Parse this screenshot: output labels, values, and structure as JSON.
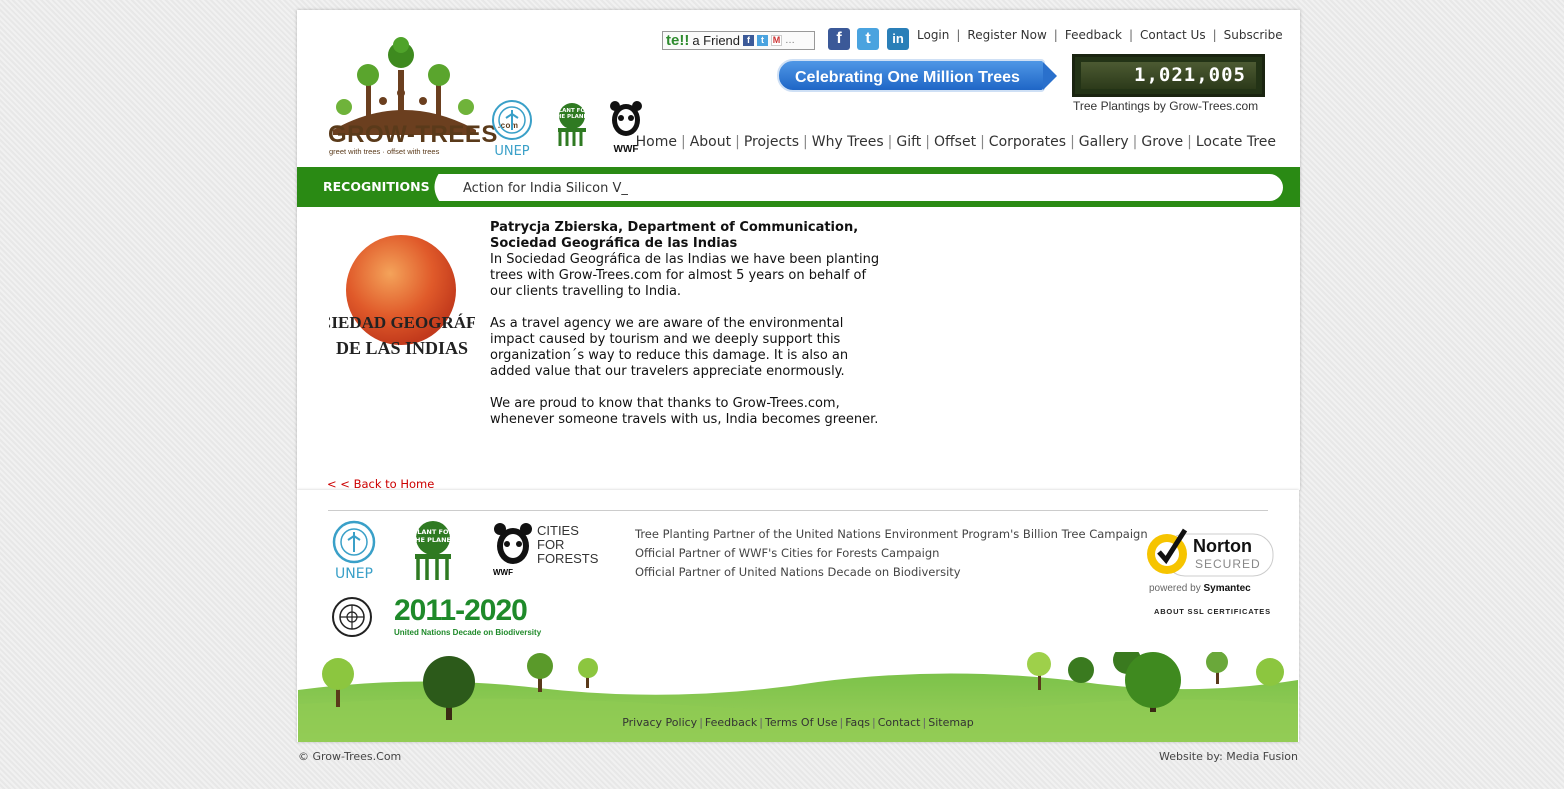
{
  "header": {
    "logo_text": "GROW-TREES",
    "logo_com": ".com",
    "logo_tagline": "greet with trees · offset with trees",
    "partners": [
      "UNEP",
      "PLANT FOR THE PLANET",
      "WWF"
    ],
    "tell_a_friend": {
      "te": "te!!",
      "label": "a Friend"
    },
    "social": [
      "f",
      "t",
      "in"
    ],
    "top_links": [
      "Login",
      "Register Now",
      "Feedback",
      "Contact Us",
      "Subscribe"
    ],
    "celebrating": "Celebrating One Million Trees",
    "counter": "1,021,005",
    "counter_caption": "Tree Plantings by Grow-Trees.com",
    "nav": [
      "Home",
      "About",
      "Projects",
      "Why Trees",
      "Gift",
      "Offset",
      "Corporates",
      "Gallery",
      "Grove",
      "Locate Tree"
    ]
  },
  "recognitions": {
    "label": "RECOGNITIONS :",
    "ticker": "Action for India Silicon V_"
  },
  "testimonial": {
    "org_logo_line1": "SOCIEDAD GEOGRÁFICA",
    "org_logo_line2": "DE LAS INDIAS",
    "name_line1": "Patrycja Zbierska, Department of Communication,",
    "name_line2": "Sociedad Geográfica de las Indias",
    "p1": "In Sociedad Geográfica de las Indias we have been planting trees with Grow-Trees.com for almost 5 years on behalf of our clients travelling to India.",
    "p2": "As a travel agency we are aware of the environmental impact caused by tourism and we deeply support this organization´s  way to reduce this damage. It is also an added value that our travelers appreciate enormously.",
    "p3": "We are proud to know that thanks to Grow-Trees.com, whenever someone travels with us, India becomes greener."
  },
  "back_link": "< < Back to Home",
  "footer": {
    "logos": [
      "UNEP",
      "PLANT FOR THE PLANET",
      "WWF",
      "CITIES FOR FORESTS",
      "2011-2020",
      "United Nations Decade on Biodiversity"
    ],
    "partner_lines": [
      "Tree Planting Partner of the United Nations Environment Program's Billion Tree Campaign",
      "Official Partner of WWF's Cities for Forests Campaign",
      "Official Partner of United Nations Decade on Biodiversity"
    ],
    "norton": {
      "brand": "Norton",
      "secured": "SECURED",
      "powered": "powered by",
      "symantec": "Symantec"
    },
    "ssl_label": "ABOUT SSL CERTIFICATES",
    "links": [
      "Privacy Policy",
      "Feedback",
      "Terms Of Use",
      "Faqs",
      "Contact",
      "Sitemap"
    ],
    "copyright": "© Grow-Trees.Com",
    "website_by": "Website by: Media Fusion"
  },
  "colors": {
    "green": "#2a8a14",
    "blue": "#1f66c6",
    "brown": "#5a3a1a",
    "red": "#cc0000"
  }
}
